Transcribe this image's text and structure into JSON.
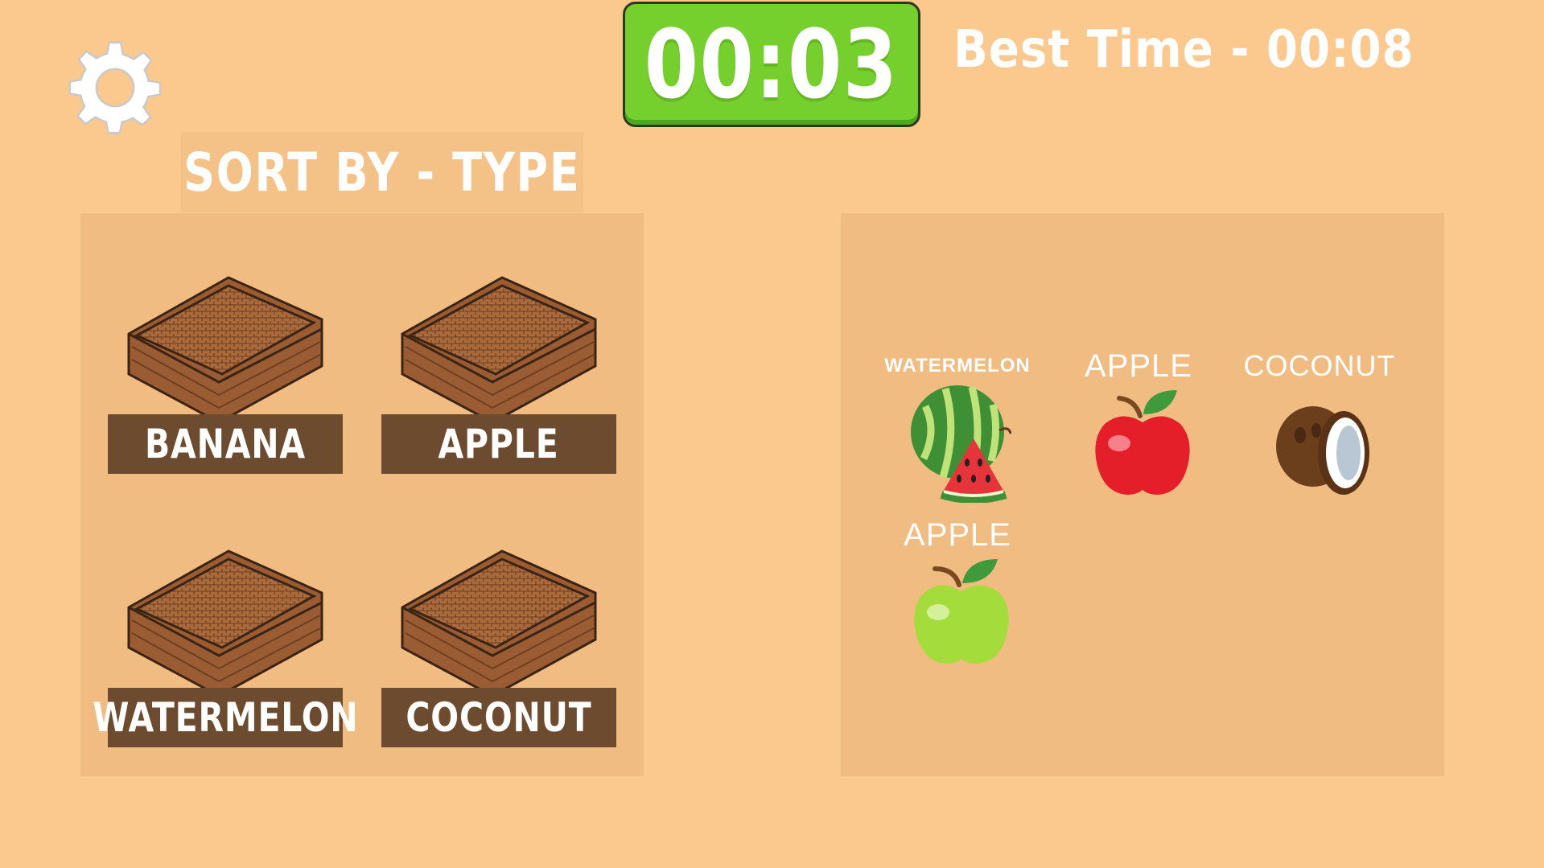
{
  "timer": {
    "value": "00:03"
  },
  "best_time": {
    "text": "Best Time - 00:08"
  },
  "sort_label": "SORT BY - TYPE",
  "icons": {
    "settings": "gear-icon"
  },
  "baskets": [
    {
      "label": "BANANA"
    },
    {
      "label": "APPLE"
    },
    {
      "label": "WATERMELON"
    },
    {
      "label": "COCONUT"
    }
  ],
  "fruits": [
    {
      "label": "WATERMELON",
      "kind": "watermelon"
    },
    {
      "label": "APPLE",
      "kind": "red-apple"
    },
    {
      "label": "COCONUT",
      "kind": "coconut"
    },
    {
      "label": "APPLE",
      "kind": "green-apple"
    }
  ],
  "colors": {
    "background": "#fbc88e",
    "timer_green": "#75cf2c",
    "basket_label": "#6d4b2e"
  }
}
